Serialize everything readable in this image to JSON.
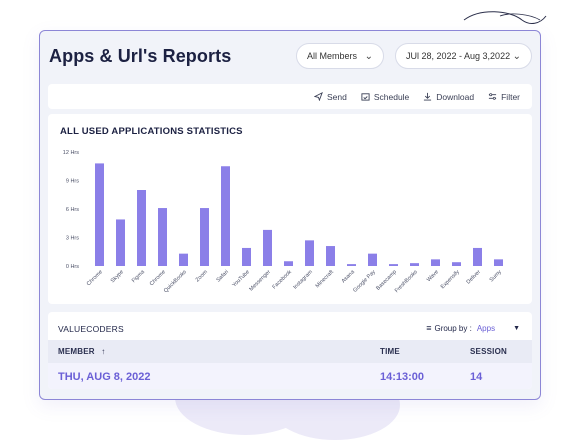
{
  "header": {
    "title": "Apps & Url's Reports",
    "members_filter": "All Members",
    "date_range": "JUl 28, 2022 - Aug 3,2022"
  },
  "toolbar": {
    "send": "Send",
    "schedule": "Schedule",
    "download": "Download",
    "filter": "Filter"
  },
  "chart_title": "ALL USED APPLICATIONS STATISTICS",
  "chart_data": {
    "type": "bar",
    "title": "ALL USED APPLICATIONS STATISTICS",
    "xlabel": "",
    "ylabel": "",
    "ylim": [
      0,
      12
    ],
    "y_ticks": [
      "0 Hrs",
      "3 Hrs",
      "6 Hrs",
      "9 Hrs",
      "12 Hrs"
    ],
    "bar_color": "#8b7fe8",
    "grid": false,
    "categories": [
      "Chrome",
      "Skype",
      "Figma",
      "Chrome",
      "QuickBooks",
      "Zoom",
      "Safari",
      "YouTube",
      "Messenger",
      "Facebook",
      "Instagram",
      "Minecraft",
      "Asana",
      "Google Pay",
      "Basecamp",
      "FreshBooks",
      "Wave",
      "Expensify",
      "Deliver",
      "Sumy"
    ],
    "values": [
      10.8,
      4.9,
      8.0,
      6.1,
      1.3,
      6.1,
      10.5,
      1.9,
      3.8,
      0.5,
      2.7,
      2.1,
      0.2,
      1.3,
      0.2,
      0.3,
      0.7,
      0.4,
      1.9,
      0.7
    ]
  },
  "table": {
    "name": "VALUECODERS",
    "group_by_label": "Group by :",
    "group_by_value": "Apps",
    "columns": {
      "member": "MEMBER",
      "member_sort": "↑",
      "time": "TIME",
      "session": "SESSION"
    },
    "rows": [
      {
        "member": "THU, AUG 8, 2022",
        "time": "14:13:00",
        "session": "14"
      }
    ]
  },
  "colors": {
    "accent": "#6a5fd6",
    "bar": "#8b7fe8",
    "card_border": "#8c86d6"
  }
}
